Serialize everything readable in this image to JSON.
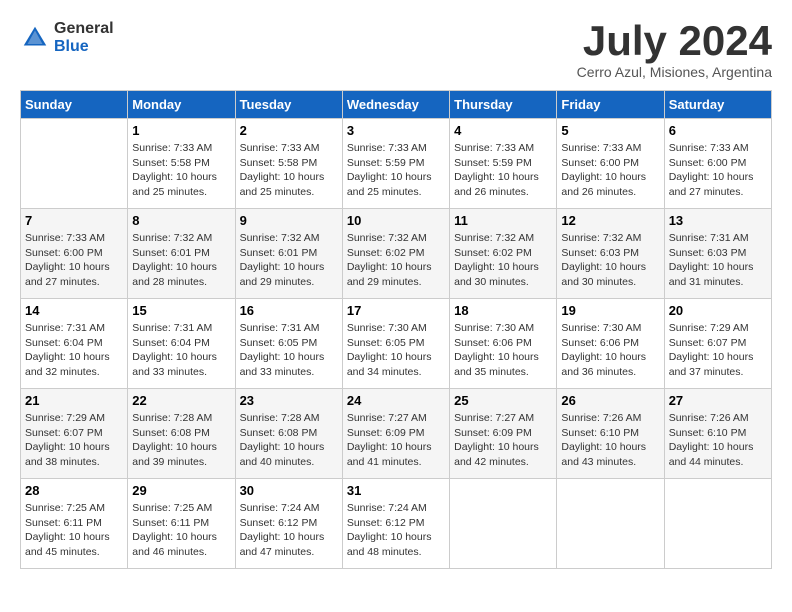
{
  "header": {
    "logo_general": "General",
    "logo_blue": "Blue",
    "month_title": "July 2024",
    "subtitle": "Cerro Azul, Misiones, Argentina"
  },
  "weekdays": [
    "Sunday",
    "Monday",
    "Tuesday",
    "Wednesday",
    "Thursday",
    "Friday",
    "Saturday"
  ],
  "weeks": [
    [
      {
        "day": "",
        "content": ""
      },
      {
        "day": "1",
        "content": "Sunrise: 7:33 AM\nSunset: 5:58 PM\nDaylight: 10 hours\nand 25 minutes."
      },
      {
        "day": "2",
        "content": "Sunrise: 7:33 AM\nSunset: 5:58 PM\nDaylight: 10 hours\nand 25 minutes."
      },
      {
        "day": "3",
        "content": "Sunrise: 7:33 AM\nSunset: 5:59 PM\nDaylight: 10 hours\nand 25 minutes."
      },
      {
        "day": "4",
        "content": "Sunrise: 7:33 AM\nSunset: 5:59 PM\nDaylight: 10 hours\nand 26 minutes."
      },
      {
        "day": "5",
        "content": "Sunrise: 7:33 AM\nSunset: 6:00 PM\nDaylight: 10 hours\nand 26 minutes."
      },
      {
        "day": "6",
        "content": "Sunrise: 7:33 AM\nSunset: 6:00 PM\nDaylight: 10 hours\nand 27 minutes."
      }
    ],
    [
      {
        "day": "7",
        "content": "Sunrise: 7:33 AM\nSunset: 6:00 PM\nDaylight: 10 hours\nand 27 minutes."
      },
      {
        "day": "8",
        "content": "Sunrise: 7:32 AM\nSunset: 6:01 PM\nDaylight: 10 hours\nand 28 minutes."
      },
      {
        "day": "9",
        "content": "Sunrise: 7:32 AM\nSunset: 6:01 PM\nDaylight: 10 hours\nand 29 minutes."
      },
      {
        "day": "10",
        "content": "Sunrise: 7:32 AM\nSunset: 6:02 PM\nDaylight: 10 hours\nand 29 minutes."
      },
      {
        "day": "11",
        "content": "Sunrise: 7:32 AM\nSunset: 6:02 PM\nDaylight: 10 hours\nand 30 minutes."
      },
      {
        "day": "12",
        "content": "Sunrise: 7:32 AM\nSunset: 6:03 PM\nDaylight: 10 hours\nand 30 minutes."
      },
      {
        "day": "13",
        "content": "Sunrise: 7:31 AM\nSunset: 6:03 PM\nDaylight: 10 hours\nand 31 minutes."
      }
    ],
    [
      {
        "day": "14",
        "content": "Sunrise: 7:31 AM\nSunset: 6:04 PM\nDaylight: 10 hours\nand 32 minutes."
      },
      {
        "day": "15",
        "content": "Sunrise: 7:31 AM\nSunset: 6:04 PM\nDaylight: 10 hours\nand 33 minutes."
      },
      {
        "day": "16",
        "content": "Sunrise: 7:31 AM\nSunset: 6:05 PM\nDaylight: 10 hours\nand 33 minutes."
      },
      {
        "day": "17",
        "content": "Sunrise: 7:30 AM\nSunset: 6:05 PM\nDaylight: 10 hours\nand 34 minutes."
      },
      {
        "day": "18",
        "content": "Sunrise: 7:30 AM\nSunset: 6:06 PM\nDaylight: 10 hours\nand 35 minutes."
      },
      {
        "day": "19",
        "content": "Sunrise: 7:30 AM\nSunset: 6:06 PM\nDaylight: 10 hours\nand 36 minutes."
      },
      {
        "day": "20",
        "content": "Sunrise: 7:29 AM\nSunset: 6:07 PM\nDaylight: 10 hours\nand 37 minutes."
      }
    ],
    [
      {
        "day": "21",
        "content": "Sunrise: 7:29 AM\nSunset: 6:07 PM\nDaylight: 10 hours\nand 38 minutes."
      },
      {
        "day": "22",
        "content": "Sunrise: 7:28 AM\nSunset: 6:08 PM\nDaylight: 10 hours\nand 39 minutes."
      },
      {
        "day": "23",
        "content": "Sunrise: 7:28 AM\nSunset: 6:08 PM\nDaylight: 10 hours\nand 40 minutes."
      },
      {
        "day": "24",
        "content": "Sunrise: 7:27 AM\nSunset: 6:09 PM\nDaylight: 10 hours\nand 41 minutes."
      },
      {
        "day": "25",
        "content": "Sunrise: 7:27 AM\nSunset: 6:09 PM\nDaylight: 10 hours\nand 42 minutes."
      },
      {
        "day": "26",
        "content": "Sunrise: 7:26 AM\nSunset: 6:10 PM\nDaylight: 10 hours\nand 43 minutes."
      },
      {
        "day": "27",
        "content": "Sunrise: 7:26 AM\nSunset: 6:10 PM\nDaylight: 10 hours\nand 44 minutes."
      }
    ],
    [
      {
        "day": "28",
        "content": "Sunrise: 7:25 AM\nSunset: 6:11 PM\nDaylight: 10 hours\nand 45 minutes."
      },
      {
        "day": "29",
        "content": "Sunrise: 7:25 AM\nSunset: 6:11 PM\nDaylight: 10 hours\nand 46 minutes."
      },
      {
        "day": "30",
        "content": "Sunrise: 7:24 AM\nSunset: 6:12 PM\nDaylight: 10 hours\nand 47 minutes."
      },
      {
        "day": "31",
        "content": "Sunrise: 7:24 AM\nSunset: 6:12 PM\nDaylight: 10 hours\nand 48 minutes."
      },
      {
        "day": "",
        "content": ""
      },
      {
        "day": "",
        "content": ""
      },
      {
        "day": "",
        "content": ""
      }
    ]
  ]
}
